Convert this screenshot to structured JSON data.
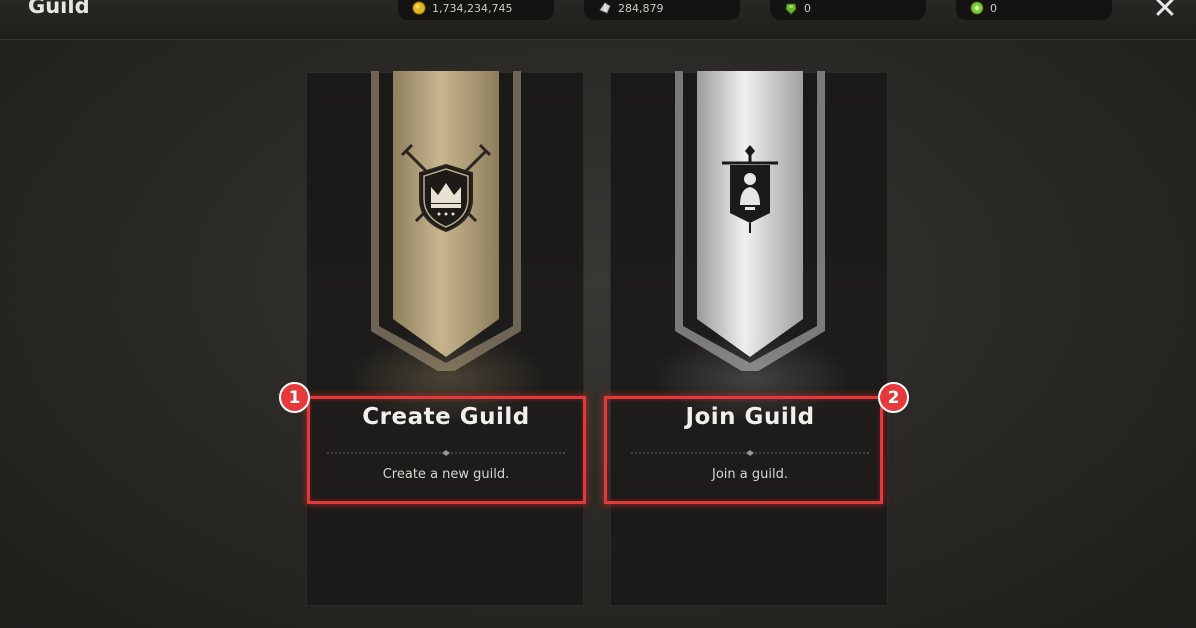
{
  "header": {
    "title": "Guild",
    "close_symbol": "✕"
  },
  "currencies": [
    {
      "icon": "gold-coin-icon",
      "value": "1,734,234,745",
      "color": "#e6b820"
    },
    {
      "icon": "crystal-icon",
      "value": "284,879",
      "color": "#c8c8c8"
    },
    {
      "icon": "green-gem-icon",
      "value": "0",
      "color": "#6ab82a"
    },
    {
      "icon": "green-orb-icon",
      "value": "0",
      "color": "#7ac83a"
    }
  ],
  "cards": {
    "create": {
      "title": "Create Guild",
      "description": "Create a new guild.",
      "banner_color": "#b8a57f",
      "icon": "crowned-shield-crossed-swords-icon"
    },
    "join": {
      "title": "Join Guild",
      "description": "Join a guild.",
      "banner_color": "#cfcfcf",
      "icon": "flag-banner-icon"
    }
  },
  "annotations": [
    {
      "label": "1",
      "color": "#e5393c"
    },
    {
      "label": "2",
      "color": "#e5393c"
    }
  ]
}
